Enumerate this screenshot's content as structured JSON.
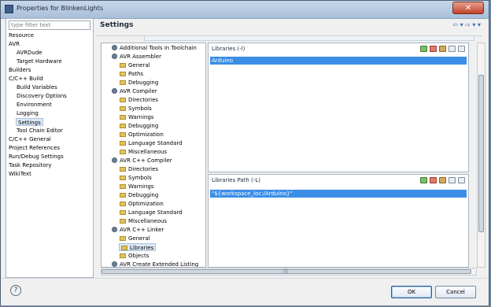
{
  "window": {
    "title": "Properties for BlinkenLights",
    "close_label": "✕"
  },
  "filter": {
    "placeholder": "type filter text"
  },
  "nav": {
    "items": [
      {
        "label": "Resource"
      },
      {
        "label": "AVR"
      },
      {
        "label": "AVRDude"
      },
      {
        "label": "Target Hardware"
      },
      {
        "label": "Builders"
      },
      {
        "label": "C/C++ Build"
      },
      {
        "label": "Build Variables"
      },
      {
        "label": "Discovery Options"
      },
      {
        "label": "Environment"
      },
      {
        "label": "Logging"
      },
      {
        "label": "Settings"
      },
      {
        "label": "Tool Chain Editor"
      },
      {
        "label": "C/C++ General"
      },
      {
        "label": "Project References"
      },
      {
        "label": "Run/Debug Settings"
      },
      {
        "label": "Task Repository"
      },
      {
        "label": "WikiText"
      }
    ]
  },
  "main": {
    "title": "Settings",
    "back_glyph": "⇦",
    "forward_glyph": "⇨",
    "menu_glyph": "▾"
  },
  "tree": {
    "nodes": [
      {
        "label": "Additional Tools in Toolchain"
      },
      {
        "label": "AVR Assembler"
      },
      {
        "label": "General"
      },
      {
        "label": "Paths"
      },
      {
        "label": "Debugging"
      },
      {
        "label": "AVR Compiler"
      },
      {
        "label": "Directories"
      },
      {
        "label": "Symbols"
      },
      {
        "label": "Warnings"
      },
      {
        "label": "Debugging"
      },
      {
        "label": "Optimization"
      },
      {
        "label": "Language Standard"
      },
      {
        "label": "Miscellaneous"
      },
      {
        "label": "AVR C++ Compiler"
      },
      {
        "label": "Directories"
      },
      {
        "label": "Symbols"
      },
      {
        "label": "Warnings"
      },
      {
        "label": "Debugging"
      },
      {
        "label": "Optimization"
      },
      {
        "label": "Language Standard"
      },
      {
        "label": "Miscellaneous"
      },
      {
        "label": "AVR C++ Linker"
      },
      {
        "label": "General"
      },
      {
        "label": "Libraries"
      },
      {
        "label": "Objects"
      },
      {
        "label": "AVR Create Extended Listing"
      }
    ]
  },
  "libraries": {
    "header": "Libraries (-l)",
    "items": [
      "Arduino"
    ]
  },
  "library_paths": {
    "header": "Libraries Path (-L)",
    "items": [
      "\"${workspace_loc:/Arduino}\""
    ]
  },
  "scrollbar": {
    "h_glyph": "|||"
  },
  "footer": {
    "help_glyph": "?",
    "ok_label": "OK",
    "cancel_label": "Cancel"
  }
}
